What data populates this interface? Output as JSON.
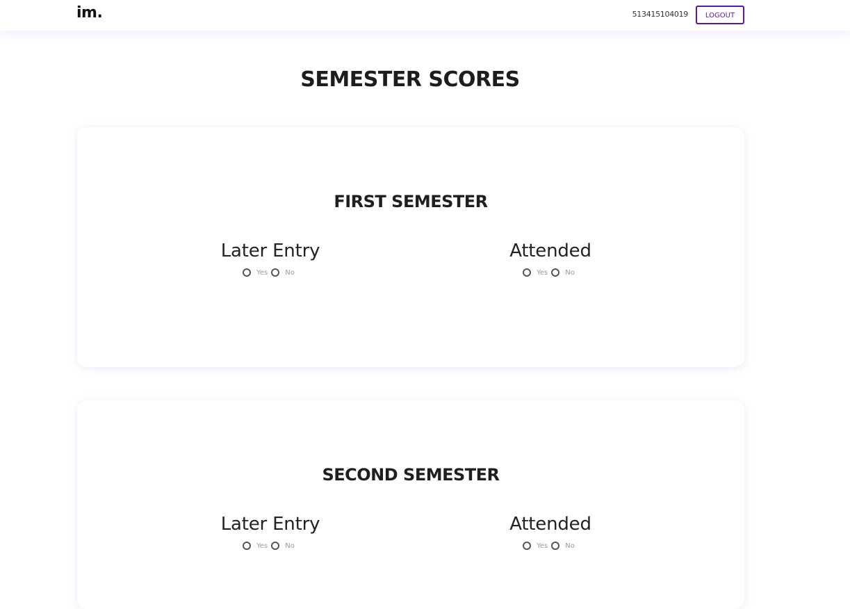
{
  "header": {
    "logo": "im.",
    "user_id": "513415104019",
    "logout_label": "LOGOUT",
    "accent_color": "#5a16a8"
  },
  "page_title": "SEMESTER SCORES",
  "semesters": [
    {
      "title": "FIRST SEMESTER",
      "fields": [
        {
          "label": "Later Entry",
          "options": [
            "Yes",
            "No"
          ]
        },
        {
          "label": "Attended",
          "options": [
            "Yes",
            "No"
          ]
        }
      ]
    },
    {
      "title": "SECOND SEMESTER",
      "fields": [
        {
          "label": "Later Entry",
          "options": [
            "Yes",
            "No"
          ]
        },
        {
          "label": "Attended",
          "options": [
            "Yes",
            "No"
          ]
        }
      ]
    }
  ]
}
